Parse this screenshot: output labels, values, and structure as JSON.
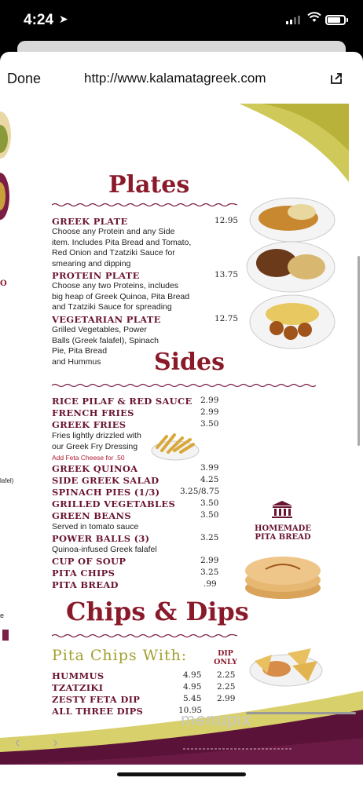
{
  "status": {
    "time": "4:24"
  },
  "browser": {
    "done_label": "Done",
    "url": "http://www.kalamatagreek.com",
    "back_icon": "chevron-left-icon",
    "forward_icon": "chevron-right-icon",
    "share_icon": "share-icon"
  },
  "menu": {
    "plates": {
      "heading": "Plates",
      "items": [
        {
          "name": "GREEK PLATE",
          "price": "12.95",
          "desc": [
            "Choose any Protein and any Side",
            "item. Includes Pita Bread and Tomato,",
            "Red Onion and Tzatziki Sauce for",
            "smearing and dipping"
          ]
        },
        {
          "name": "PROTEIN PLATE",
          "price": "13.75",
          "desc": [
            "Choose any two Proteins, includes",
            "big heap of Greek Quinoa, Pita Bread",
            "and Tzatziki Sauce for spreading"
          ]
        },
        {
          "name": "VEGETARIAN PLATE",
          "price": "12.75",
          "desc": [
            "Grilled Vegetables, Power",
            "Balls (Greek falafel), Spinach",
            "Pie, Pita Bread",
            "and Hummus"
          ]
        }
      ]
    },
    "sides": {
      "heading": "Sides",
      "items": [
        {
          "name": "RICE PILAF & RED SAUCE",
          "price": "2.99"
        },
        {
          "name": "FRENCH FRIES",
          "price": "2.99"
        },
        {
          "name": "GREEK FRIES",
          "price": "3.50"
        },
        {
          "name": "GREEK QUINOA",
          "price": "3.99"
        },
        {
          "name": "SIDE GREEK SALAD",
          "price": "4.25"
        },
        {
          "name": "SPINACH PIES (1/3)",
          "price": "3.25/8.75"
        },
        {
          "name": "GRILLED VEGETABLES",
          "price": "3.50"
        },
        {
          "name": "GREEN BEANS",
          "price": "3.50"
        },
        {
          "name": "POWER BALLS (3)",
          "price": "3.25"
        },
        {
          "name": "CUP OF SOUP",
          "price": "2.99"
        },
        {
          "name": "PITA CHIPS",
          "price": "3.25"
        },
        {
          "name": "PITA BREAD",
          "price": ".99"
        }
      ],
      "fries_desc": [
        "Fries lightly drizzled with",
        "our Greek Fry Dressing"
      ],
      "feta_note": "Add Feta Cheese for .50",
      "beans_desc": "Served in tomato sauce",
      "balls_desc": "Quinoa-infused Greek falafel",
      "homemade": [
        "HOMEMADE",
        "PITA BREAD"
      ]
    },
    "chips": {
      "heading": "Chips & Dips",
      "pita_with": "Pita Chips With:",
      "dip_only": [
        "DIP",
        "ONLY"
      ],
      "items": [
        {
          "name": "HUMMUS",
          "price": "4.95",
          "dip": "2.25"
        },
        {
          "name": "TZATZIKI",
          "price": "4.95",
          "dip": "2.25"
        },
        {
          "name": "ZESTY FETA DIP",
          "price": "5.45",
          "dip": "2.99"
        },
        {
          "name": "ALL THREE DIPS",
          "price": "10.95",
          "dip": ""
        }
      ]
    },
    "left_fragments": [
      "O",
      "lafel)",
      "e"
    ],
    "watermark": "menupix"
  }
}
